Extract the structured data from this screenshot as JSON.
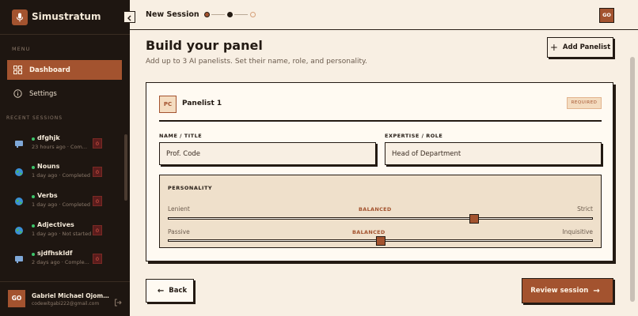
{
  "app": {
    "name": "Simustratum"
  },
  "sidebar": {
    "menu_label": "MENU",
    "items": [
      {
        "label": "Dashboard",
        "icon": "grid-icon",
        "active": true
      },
      {
        "label": "Settings",
        "icon": "info-icon",
        "active": false
      }
    ],
    "recent_label": "RECENT SESSIONS",
    "sessions": [
      {
        "title": "dfghjk",
        "meta": "23 hours ago · Com...",
        "icon": "chat-icon",
        "count": "0"
      },
      {
        "title": "Nouns",
        "meta": "1 day ago · Completed",
        "icon": "globe-icon",
        "count": "0"
      },
      {
        "title": "Verbs",
        "meta": "1 day ago · Completed",
        "icon": "globe-icon",
        "count": "0"
      },
      {
        "title": "Adjectives",
        "meta": "1 day ago · Not started",
        "icon": "globe-icon",
        "count": "0"
      },
      {
        "title": "sjdfhskldf",
        "meta": "2 days ago · Comple...",
        "icon": "chat-icon",
        "count": "0"
      }
    ],
    "user": {
      "initials": "GO",
      "name": "Gabriel Michael Ojomak...",
      "email": "codewitgabi222@gmail.com"
    }
  },
  "topbar": {
    "title": "New Session",
    "avatar_initials": "GO",
    "steps_total": 3,
    "current_step": 2
  },
  "main": {
    "title": "Build your panel",
    "subtitle": "Add up to 3 AI panelists. Set their name, role, and personality.",
    "add_button": "Add Panelist",
    "panelist": {
      "initials": "PC",
      "heading": "Panelist 1",
      "required_badge": "REQUIRED",
      "name_label": "NAME / TITLE",
      "name_value": "Prof. Code",
      "role_label": "EXPERTISE / ROLE",
      "role_value": "Head of Department",
      "personality": {
        "label": "PERSONALITY",
        "sliders": [
          {
            "left": "Lenient",
            "right": "Strict",
            "mid": "BALANCED",
            "value": 0.72
          },
          {
            "left": "Passive",
            "right": "Inquisitive",
            "mid": "BALANCED",
            "value": 0.5
          }
        ]
      }
    },
    "back_button": "Back",
    "review_button": "Review session"
  },
  "colors": {
    "accent": "#a3532f",
    "sidebar_bg": "#1e1611",
    "page_bg": "#f8efe3",
    "ink": "#231a13"
  }
}
